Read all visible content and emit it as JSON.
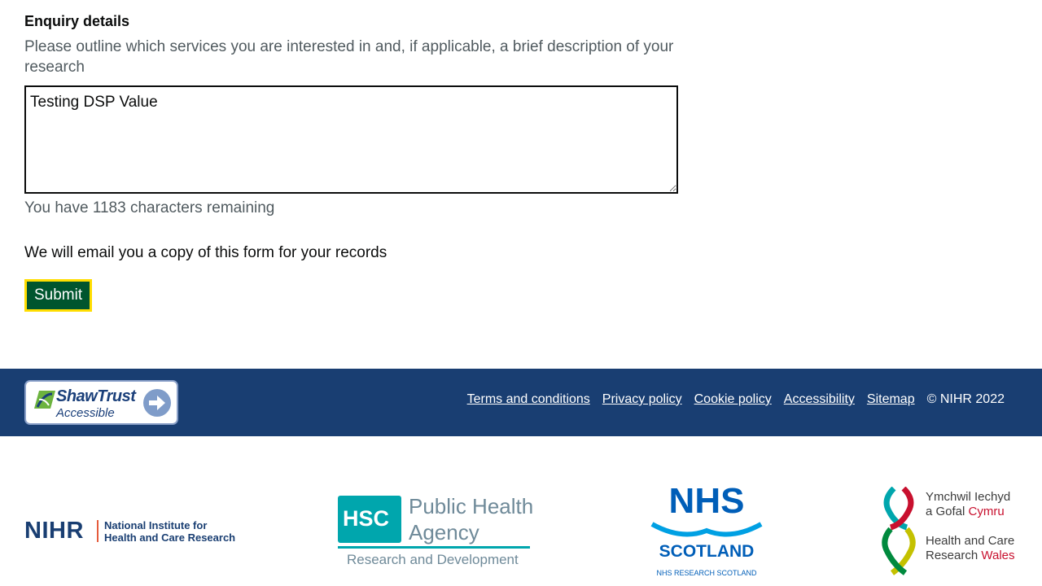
{
  "form": {
    "label": "Enquiry details",
    "hint": "Please outline which services you are interested in and, if applicable, a brief description of your research",
    "textarea_value": "Testing DSP Value",
    "char_count": "You have 1183 characters remaining",
    "email_note": "We will email you a copy of this form for your records",
    "submit_label": "Submit"
  },
  "footer": {
    "badge": {
      "brand": "ShawTrust",
      "sub": "Accessible"
    },
    "links": [
      "Terms and conditions",
      "Privacy policy",
      "Cookie policy",
      "Accessibility",
      "Sitemap"
    ],
    "copyright": "© NIHR 2022"
  },
  "partners": {
    "nihr": {
      "mark": "NIHR",
      "line1": "National Institute for",
      "line2": "Health and Care Research"
    },
    "hsc": {
      "box": "HSC",
      "line1": "Public Health",
      "line2": "Agency",
      "line3": "Research and Development"
    },
    "nhs_scotland": {
      "mark": "NHS",
      "region": "SCOTLAND",
      "sub": "NHS RESEARCH SCOTLAND"
    },
    "hcrw": {
      "line1": "Ymchwil Iechyd",
      "line2a": "a Gofal ",
      "line2b": "Cymru",
      "line3": "Health and Care",
      "line4a": "Research ",
      "line4b": "Wales"
    }
  },
  "colors": {
    "footer_bg": "#193e72",
    "submit_bg": "#00552e",
    "focus": "#ffdd00",
    "hsc_teal": "#00a6ad",
    "nhs_blue": "#005eb8"
  }
}
